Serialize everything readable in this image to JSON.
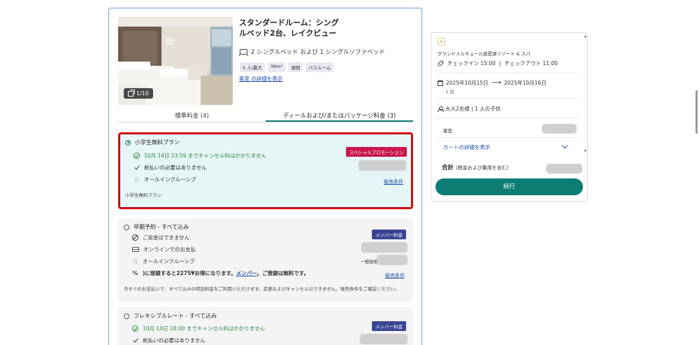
{
  "room": {
    "photo_count": "1/10",
    "title": "スタンダードルーム：シングルベッド2台、レイクビュー",
    "beds": "2 シングルベッド および 1 シングルソファベッド",
    "tags": [
      "5 人/最大",
      "36m²",
      "湖側",
      "バスルーム"
    ],
    "details_link": "客室 の詳細を表示"
  },
  "tabs": [
    {
      "label": "標準料金 (4)"
    },
    {
      "label": "ディールおよび/またはパッケージ料金 (3)"
    }
  ],
  "rates": [
    {
      "name": "小学生無料プラン",
      "selected": true,
      "features": [
        "10月 14日 23:59 までキャンセル料はかかりません",
        "前払いの必要はありません",
        "オールインクルーシブ"
      ],
      "badge": "スペシャルプロモーション",
      "terms": "販売条件",
      "note": "小学生無料プラン"
    },
    {
      "name": "早期予約 - すべて込み",
      "selected": false,
      "features": [
        "ご返金はできません",
        "オンラインでのお支払",
        "オールインクルーシブ"
      ],
      "member_line_prefix": ")に登録すると2275¥お得になります。",
      "member_link": "メンバー",
      "member_line_suffix": "。ご登録は無料です。",
      "badge": "メンバー料金",
      "public_price_label": "一般価格",
      "terms": "販売条件",
      "note": "今すぐのお支払いで、すべて込みの特別料金をご利用いただけます。変更およびキャンセルはできません。販売条件をご確認ください。"
    },
    {
      "name": "フレキシブルレート - すべて込み",
      "selected": false,
      "features": [
        "10月 14日 18:00 までキャンセル料はかかりません",
        "前払いの必要はありません"
      ],
      "badge": "メンバー料金"
    }
  ],
  "summary": {
    "hotel": "グランドメルキュール琵琶湖リゾート & スパ",
    "checkin": "チェックイン 15:00",
    "checkout": "チェックアウト 11:00",
    "separator": "|",
    "date_from": "2025年10月15日",
    "date_to": "2025年10月16日",
    "arrow": "⟶",
    "nights": "1 泊",
    "guests": "大人2名様 | 1 人の子供",
    "room_label": "客室",
    "cart_details": "カートの詳細を表示",
    "total_label": "合計",
    "total_sub": "(税金および費用を含む)",
    "reserve_button": "続行"
  },
  "colors": {
    "accent": "#0d7d74",
    "promo": "#c8174e",
    "member": "#3a4596",
    "link": "#1d4fa8",
    "highlight_border": "#e01010"
  }
}
